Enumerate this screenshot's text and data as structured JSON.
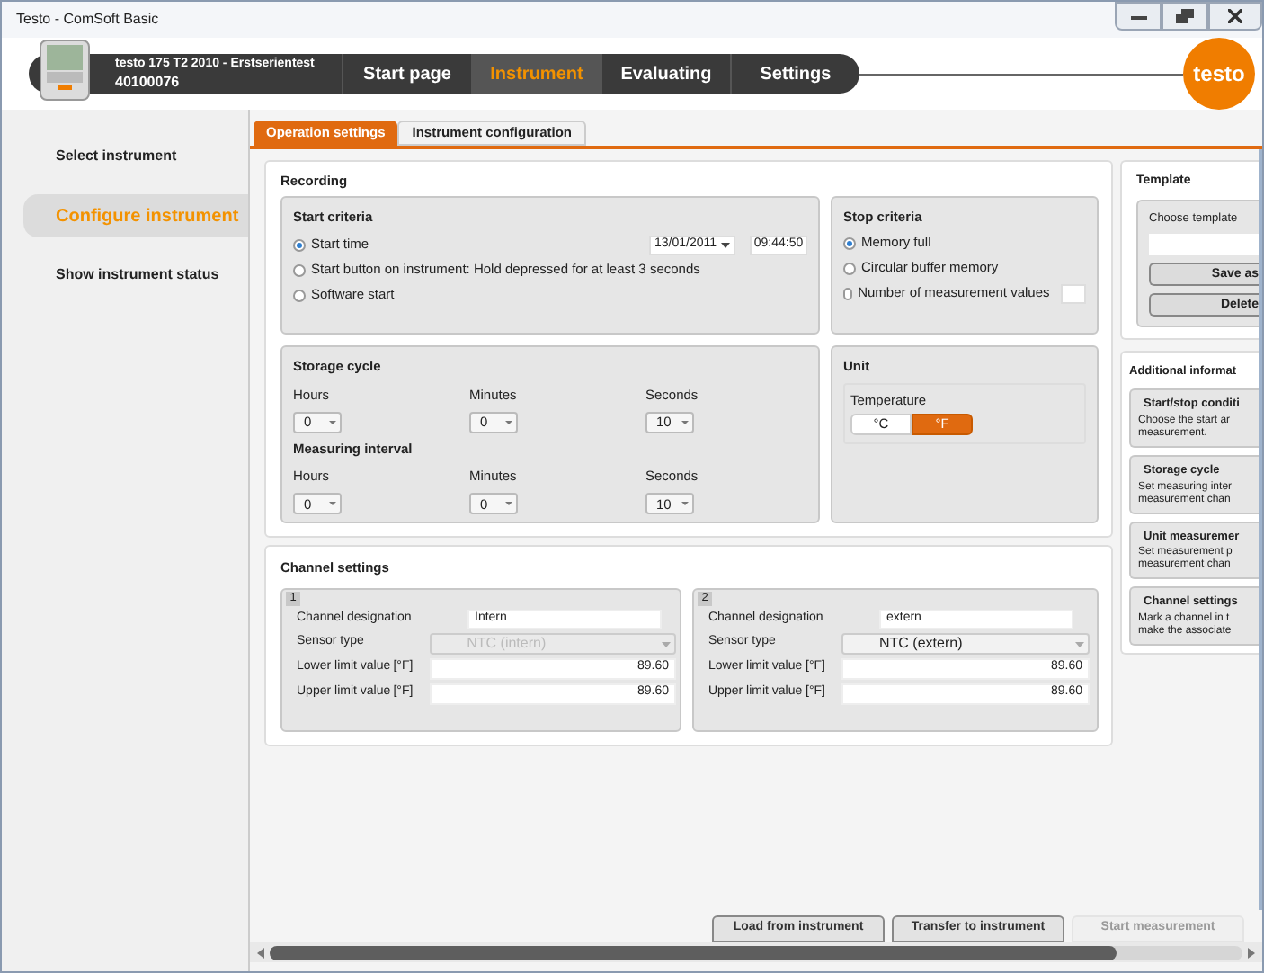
{
  "window": {
    "title": "Testo - ComSoft Basic"
  },
  "header": {
    "instrument_name": "testo 175 T2 2010 - Erstserientest",
    "serial": "40100076",
    "logo": "testo",
    "nav": [
      {
        "label": "Start page",
        "selected": false
      },
      {
        "label": "Instrument",
        "selected": true
      },
      {
        "label": "Evaluating",
        "selected": false
      },
      {
        "label": "Settings",
        "selected": false
      }
    ]
  },
  "sidebar": {
    "items": [
      {
        "label": "Select instrument",
        "selected": false
      },
      {
        "label": "Configure instrument",
        "selected": true
      },
      {
        "label": "Show instrument status",
        "selected": false
      }
    ]
  },
  "tabs": [
    {
      "label": "Operation settings",
      "selected": true
    },
    {
      "label": "Instrument configuration",
      "selected": false
    }
  ],
  "recording": {
    "title": "Recording",
    "start_criteria": {
      "title": "Start criteria",
      "date": "13/01/2011",
      "time": "09:44:50",
      "options": [
        {
          "label": "Start time",
          "selected": true
        },
        {
          "label": "Start button on instrument: Hold depressed for at least 3 seconds",
          "selected": false
        },
        {
          "label": "Software start",
          "selected": false
        }
      ]
    },
    "stop_criteria": {
      "title": "Stop criteria",
      "options": [
        {
          "label": "Memory full",
          "selected": true
        },
        {
          "label": "Circular buffer memory",
          "selected": false
        },
        {
          "label": "Number of measurement values",
          "selected": false
        }
      ]
    },
    "storage_cycle": {
      "title": "Storage cycle",
      "fields": [
        {
          "label": "Hours",
          "value": "0"
        },
        {
          "label": "Minutes",
          "value": "0"
        },
        {
          "label": "Seconds",
          "value": "10"
        }
      ]
    },
    "measuring_interval": {
      "title": "Measuring interval",
      "fields": [
        {
          "label": "Hours",
          "value": "0"
        },
        {
          "label": "Minutes",
          "value": "0"
        },
        {
          "label": "Seconds",
          "value": "10"
        }
      ]
    },
    "unit": {
      "title": "Unit",
      "label": "Temperature",
      "options": [
        {
          "label": "°C",
          "selected": false
        },
        {
          "label": "°F",
          "selected": true
        }
      ]
    }
  },
  "channel_settings": {
    "title": "Channel settings",
    "channels": [
      {
        "number": "1",
        "designation_label": "Channel designation",
        "designation": "Intern",
        "sensor_label": "Sensor type",
        "sensor": "NTC (intern)",
        "sensor_disabled": true,
        "lower_label": "Lower limit value",
        "lower_unit": "[°F]",
        "lower": "89.60",
        "upper_label": "Upper limit value",
        "upper_unit": "[°F]",
        "upper": "89.60"
      },
      {
        "number": "2",
        "designation_label": "Channel designation",
        "designation": "extern",
        "sensor_label": "Sensor type",
        "sensor": "NTC (extern)",
        "sensor_disabled": false,
        "lower_label": "Lower limit value",
        "lower_unit": "[°F]",
        "lower": "89.60",
        "upper_label": "Upper limit value",
        "upper_unit": "[°F]",
        "upper": "89.60"
      }
    ]
  },
  "template": {
    "title": "Template",
    "label": "Choose template",
    "buttons": [
      "Save as",
      "Delete"
    ]
  },
  "additional_info": {
    "title": "Additional informat",
    "cards": [
      {
        "title": "Start/stop conditi",
        "text": [
          "Choose the start ar",
          "measurement."
        ]
      },
      {
        "title": "Storage cycle",
        "text": [
          "Set measuring inter",
          "measurement chan"
        ]
      },
      {
        "title": "Unit measuremer",
        "text": [
          "Set measurement p",
          "measurement chan"
        ]
      },
      {
        "title": "Channel settings",
        "text": [
          "Mark a channel in t",
          "make the associate"
        ]
      }
    ]
  },
  "footer_buttons": [
    {
      "label": "Load from instrument",
      "disabled": false
    },
    {
      "label": "Transfer to instrument",
      "disabled": false
    },
    {
      "label": "Start measurement",
      "disabled": true
    }
  ]
}
